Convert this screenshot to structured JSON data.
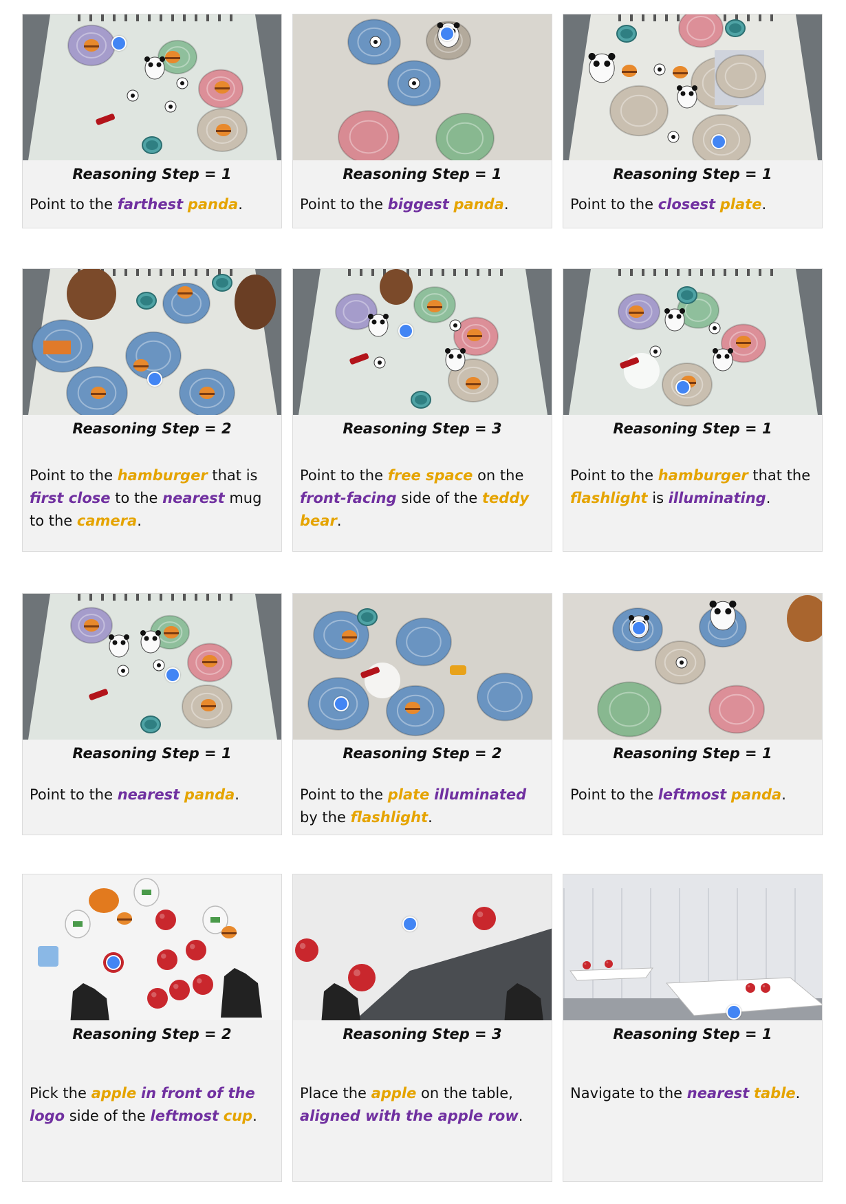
{
  "colors": {
    "object": "#e5a400",
    "attribute": "#7030a0",
    "point": "#4285f4"
  },
  "cards": [
    {
      "step": "Reasoning Step = 1",
      "dot": true,
      "segments": [
        {
          "t": "Point to the ",
          "c": ""
        },
        {
          "t": "farthest",
          "c": "purple"
        },
        {
          "t": " ",
          "c": ""
        },
        {
          "t": "panda",
          "c": "gold"
        },
        {
          "t": ".",
          "c": ""
        }
      ]
    },
    {
      "step": "Reasoning Step = 1",
      "dot": true,
      "segments": [
        {
          "t": "Point to the ",
          "c": ""
        },
        {
          "t": "biggest",
          "c": "purple"
        },
        {
          "t": " ",
          "c": ""
        },
        {
          "t": "panda",
          "c": "gold"
        },
        {
          "t": ".",
          "c": ""
        }
      ]
    },
    {
      "step": "Reasoning Step = 1",
      "dot": true,
      "segments": [
        {
          "t": "Point to the ",
          "c": ""
        },
        {
          "t": "closest",
          "c": "purple"
        },
        {
          "t": " ",
          "c": ""
        },
        {
          "t": "plate",
          "c": "gold"
        },
        {
          "t": ".",
          "c": ""
        }
      ]
    },
    {
      "step": "Reasoning Step = 2",
      "dot": true,
      "segments": [
        {
          "t": "Point to the ",
          "c": ""
        },
        {
          "t": "hamburger",
          "c": "gold"
        },
        {
          "t": " that is ",
          "c": ""
        },
        {
          "t": "first close",
          "c": "purple"
        },
        {
          "t": " to the ",
          "c": ""
        },
        {
          "t": "nearest",
          "c": "purple"
        },
        {
          "t": " mug to the ",
          "c": ""
        },
        {
          "t": "camera",
          "c": "gold"
        },
        {
          "t": ".",
          "c": ""
        }
      ]
    },
    {
      "step": "Reasoning Step = 3",
      "dot": true,
      "segments": [
        {
          "t": "Point to the ",
          "c": ""
        },
        {
          "t": "free space",
          "c": "gold"
        },
        {
          "t": " on the ",
          "c": ""
        },
        {
          "t": "front-facing",
          "c": "purple"
        },
        {
          "t": " side of the ",
          "c": ""
        },
        {
          "t": "teddy bear",
          "c": "gold"
        },
        {
          "t": ".",
          "c": ""
        }
      ]
    },
    {
      "step": "Reasoning Step = 1",
      "dot": true,
      "segments": [
        {
          "t": "Point to the ",
          "c": ""
        },
        {
          "t": "hamburger",
          "c": "gold"
        },
        {
          "t": " that the ",
          "c": ""
        },
        {
          "t": "flashlight",
          "c": "gold"
        },
        {
          "t": " is ",
          "c": ""
        },
        {
          "t": "illuminating",
          "c": "purple"
        },
        {
          "t": ".",
          "c": ""
        }
      ]
    },
    {
      "step": "Reasoning Step = 1",
      "dot": true,
      "segments": [
        {
          "t": "Point to the ",
          "c": ""
        },
        {
          "t": "nearest",
          "c": "purple"
        },
        {
          "t": " ",
          "c": ""
        },
        {
          "t": "panda",
          "c": "gold"
        },
        {
          "t": ".",
          "c": ""
        }
      ]
    },
    {
      "step": "Reasoning Step = 2",
      "dot": true,
      "segments": [
        {
          "t": "Point to the ",
          "c": ""
        },
        {
          "t": "plate",
          "c": "gold"
        },
        {
          "t": " ",
          "c": ""
        },
        {
          "t": "illuminated",
          "c": "purple"
        },
        {
          "t": " by the ",
          "c": ""
        },
        {
          "t": "flashlight",
          "c": "gold"
        },
        {
          "t": ".",
          "c": ""
        }
      ]
    },
    {
      "step": "Reasoning Step = 1",
      "dot": true,
      "segments": [
        {
          "t": "Point to the ",
          "c": ""
        },
        {
          "t": "leftmost",
          "c": "purple"
        },
        {
          "t": " ",
          "c": ""
        },
        {
          "t": "panda",
          "c": "gold"
        },
        {
          "t": ".",
          "c": ""
        }
      ]
    },
    {
      "step": "Reasoning Step = 2",
      "dot": true,
      "segments": [
        {
          "t": "Pick the ",
          "c": ""
        },
        {
          "t": "apple",
          "c": "gold"
        },
        {
          "t": " ",
          "c": ""
        },
        {
          "t": "in front of the logo",
          "c": "purple"
        },
        {
          "t": " side of the ",
          "c": ""
        },
        {
          "t": "leftmost",
          "c": "purple"
        },
        {
          "t": " ",
          "c": ""
        },
        {
          "t": "cup",
          "c": "gold"
        },
        {
          "t": ".",
          "c": ""
        }
      ]
    },
    {
      "step": "Reasoning Step = 3",
      "dot": true,
      "segments": [
        {
          "t": "Place the ",
          "c": ""
        },
        {
          "t": "apple",
          "c": "gold"
        },
        {
          "t": " on the table, ",
          "c": ""
        },
        {
          "t": "aligned with the apple row",
          "c": "purple"
        },
        {
          "t": ".",
          "c": ""
        }
      ]
    },
    {
      "step": "Reasoning Step = 1",
      "dot": true,
      "segments": [
        {
          "t": "Navigate to the ",
          "c": ""
        },
        {
          "t": "nearest",
          "c": "purple"
        },
        {
          "t": " ",
          "c": ""
        },
        {
          "t": "table",
          "c": "gold"
        },
        {
          "t": ".",
          "c": ""
        }
      ]
    }
  ]
}
